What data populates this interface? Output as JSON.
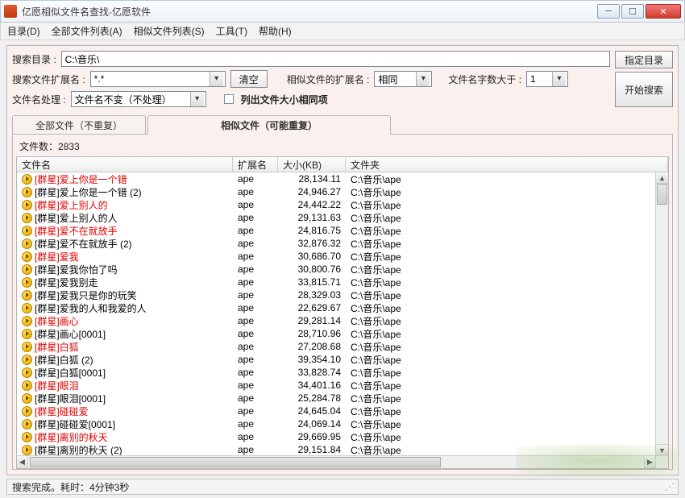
{
  "window": {
    "title": "亿愿相似文件名查找-亿愿软件"
  },
  "menu": {
    "dir": "目录(D)",
    "all": "全部文件列表(A)",
    "sim": "相似文件列表(S)",
    "tool": "工具(T)",
    "help": "帮助(H)"
  },
  "form": {
    "search_dir_lbl": "搜索目录 :",
    "search_dir_val": "C:\\音乐\\",
    "select_dir_btn": "指定目录",
    "ext_lbl": "搜索文件扩展名 :",
    "ext_val": "*.*",
    "clear_btn": "清空",
    "sim_ext_lbl": "相似文件的扩展名 :",
    "sim_ext_val": "相同",
    "min_chars_lbl": "文件名字数大于 :",
    "min_chars_val": "1",
    "process_lbl": "文件名处理 :",
    "process_val": "文件名不变（不处理）",
    "same_size_chk": "列出文件大小相同项",
    "start_btn": "开始搜索"
  },
  "tabs": {
    "t1": "全部文件（不重复）",
    "t2": "相似文件（可能重复）"
  },
  "count_lbl": "文件数：",
  "count_val": "2833",
  "columns": {
    "name": "文件名",
    "ext": "扩展名",
    "size": "大小(KB)",
    "folder": "文件夹"
  },
  "rows": [
    {
      "n": "[群星]爱上你是一个错",
      "e": "ape",
      "s": "28,134.11",
      "f": "C:\\音乐\\ape",
      "h": true
    },
    {
      "n": "[群星]爱上你是一个错 (2)",
      "e": "ape",
      "s": "24,946.27",
      "f": "C:\\音乐\\ape",
      "h": false
    },
    {
      "n": "[群星]爱上别人的",
      "e": "ape",
      "s": "24,442.22",
      "f": "C:\\音乐\\ape",
      "h": true
    },
    {
      "n": "[群星]爱上别人的人",
      "e": "ape",
      "s": "29,131.63",
      "f": "C:\\音乐\\ape",
      "h": false
    },
    {
      "n": "[群星]爱不在就放手",
      "e": "ape",
      "s": "24,816.75",
      "f": "C:\\音乐\\ape",
      "h": true
    },
    {
      "n": "[群星]爱不在就放手 (2)",
      "e": "ape",
      "s": "32,876.32",
      "f": "C:\\音乐\\ape",
      "h": false
    },
    {
      "n": "[群星]爱我",
      "e": "ape",
      "s": "30,686.70",
      "f": "C:\\音乐\\ape",
      "h": true
    },
    {
      "n": "[群星]爱我你怕了吗",
      "e": "ape",
      "s": "30,800.76",
      "f": "C:\\音乐\\ape",
      "h": false
    },
    {
      "n": "[群星]爱我别走",
      "e": "ape",
      "s": "33,815.71",
      "f": "C:\\音乐\\ape",
      "h": false
    },
    {
      "n": "[群星]爱我只是你的玩笑",
      "e": "ape",
      "s": "28,329.03",
      "f": "C:\\音乐\\ape",
      "h": false
    },
    {
      "n": "[群星]爱我的人和我爱的人",
      "e": "ape",
      "s": "22,629.67",
      "f": "C:\\音乐\\ape",
      "h": false
    },
    {
      "n": "[群星]画心",
      "e": "ape",
      "s": "29,281.14",
      "f": "C:\\音乐\\ape",
      "h": true
    },
    {
      "n": "[群星]画心[0001]",
      "e": "ape",
      "s": "28,710.96",
      "f": "C:\\音乐\\ape",
      "h": false
    },
    {
      "n": "[群星]白狐",
      "e": "ape",
      "s": "27,208.68",
      "f": "C:\\音乐\\ape",
      "h": true
    },
    {
      "n": "[群星]白狐 (2)",
      "e": "ape",
      "s": "39,354.10",
      "f": "C:\\音乐\\ape",
      "h": false
    },
    {
      "n": "[群星]白狐[0001]",
      "e": "ape",
      "s": "33,828.74",
      "f": "C:\\音乐\\ape",
      "h": false
    },
    {
      "n": "[群星]眼泪",
      "e": "ape",
      "s": "34,401.16",
      "f": "C:\\音乐\\ape",
      "h": true
    },
    {
      "n": "[群星]眼泪[0001]",
      "e": "ape",
      "s": "25,284.78",
      "f": "C:\\音乐\\ape",
      "h": false
    },
    {
      "n": "[群星]碰碰爱",
      "e": "ape",
      "s": "24,645.04",
      "f": "C:\\音乐\\ape",
      "h": true
    },
    {
      "n": "[群星]碰碰爱[0001]",
      "e": "ape",
      "s": "24,069.14",
      "f": "C:\\音乐\\ape",
      "h": false
    },
    {
      "n": "[群星]离别的秋天",
      "e": "ape",
      "s": "29,669.95",
      "f": "C:\\音乐\\ape",
      "h": true
    },
    {
      "n": "[群星]离别的秋天 (2)",
      "e": "ape",
      "s": "29,151.84",
      "f": "C:\\音乐\\ape",
      "h": false
    }
  ],
  "status": "搜索完成。耗时：4分钟3秒"
}
